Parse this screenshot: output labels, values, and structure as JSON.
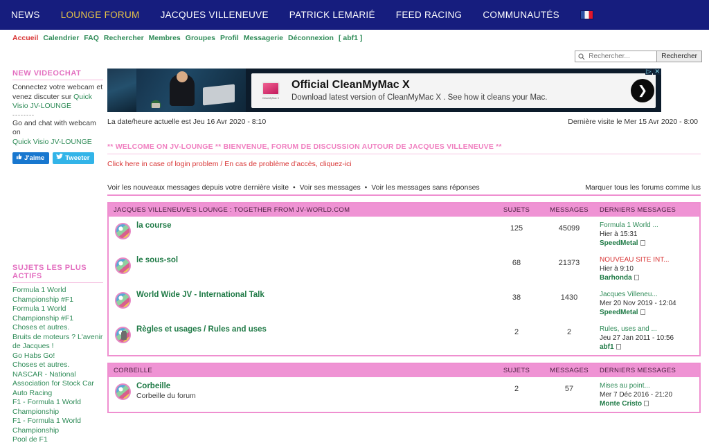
{
  "colors": {
    "nav_bg": "#161d7e",
    "nav_active": "#e8c547",
    "pink": "#ef93d4",
    "green_link": "#2e8b57",
    "red_link": "#d83535"
  },
  "topnav": {
    "items": [
      {
        "label": "NEWS",
        "active": false
      },
      {
        "label": "LOUNGE FORUM",
        "active": true
      },
      {
        "label": "JACQUES VILLENEUVE",
        "active": false
      },
      {
        "label": "PATRICK LEMARIÉ",
        "active": false
      },
      {
        "label": "FEED RACING",
        "active": false
      },
      {
        "label": "COMMUNAUTÉS",
        "active": false
      }
    ],
    "flag_icon": "flag-france-icon"
  },
  "subnav": {
    "items": [
      "Accueil",
      "Calendrier",
      "FAQ",
      "Rechercher",
      "Membres",
      "Groupes",
      "Profil",
      "Messagerie",
      "Déconnexion"
    ],
    "username_bracket": "[ abf1 ]"
  },
  "search": {
    "placeholder": "Rechercher...",
    "value": "",
    "button_label": "Rechercher",
    "icon": "search-icon"
  },
  "sidebar": {
    "videochat": {
      "heading": "NEW VIDEOCHAT",
      "line1": "Connectez votre webcam et",
      "line2": "venez discuter sur",
      "link1": "Quick Visio JV-LOUNGE",
      "divider": "--------",
      "line3": "Go and chat with webcam on",
      "link2": "Quick Visio JV-LOUNGE"
    },
    "social": {
      "facebook_label": "J'aime",
      "facebook_icon": "thumbs-up-icon",
      "twitter_label": "Tweeter",
      "twitter_icon": "twitter-bird-icon"
    },
    "active_topics": {
      "heading": "SUJETS LES PLUS ACTIFS",
      "items": [
        "Formula 1 World Championship #F1",
        "Formula 1 World Championship #F1",
        "Choses et autres.",
        "Bruits de moteurs ? L'avenir de Jacques !",
        "Go Habs Go!",
        "Choses et autres.",
        "NASCAR - National Association for Stock Car Auto Racing",
        "F1 - Formula 1 World Championship",
        "F1 - Formula 1 World Championship",
        "Pool de F1"
      ]
    }
  },
  "ad": {
    "title": "Official CleanMyMac X",
    "description": "Download latest version of CleanMyMac X . See how it cleans your Mac.",
    "icon_label": "CleanMyMac X",
    "arrow_icon": "chevron-right-icon",
    "adchoices_icon": "adchoices-icon",
    "close_icon": "close-icon"
  },
  "datebar": {
    "current": "La date/heure actuelle est Jeu 16 Avr 2020 - 8:10",
    "last_visit": "Dernière visite le Mer 15 Avr 2020 - 8:00"
  },
  "welcome": {
    "heading": "** WELCOME ON JV-LOUNGE ** BIENVENUE, FORUM DE DISCUSSION AUTOUR DE JACQUES VILLENEUVE **",
    "login_link": "Click here in case of login problem / En cas de problème d'accès, cliquez-ici"
  },
  "quicklinks": {
    "new_messages": "Voir les nouveaux messages depuis votre dernière visite",
    "own_messages": "Voir ses messages",
    "unanswered": "Voir les messages sans réponses",
    "separator": "•",
    "mark_read": "Marquer tous les forums comme lus"
  },
  "forum_sections": [
    {
      "title": "JACQUES VILLENEUVE'S LOUNGE : TOGETHER FROM JV-WORLD.COM",
      "col_subjects": "SUJETS",
      "col_messages": "MESSAGES",
      "col_last": "DERNIERS MESSAGES",
      "rows": [
        {
          "name": "la course",
          "desc": "",
          "subjects": "125",
          "messages": "45099",
          "last_topic": "Formula 1 World ...",
          "last_topic_red": false,
          "last_date": "Hier à 15:31",
          "last_author": "SpeedMetal",
          "icon": "forum-globe-icon",
          "locked": false
        },
        {
          "name": "le sous-sol",
          "desc": "",
          "subjects": "68",
          "messages": "21373",
          "last_topic": "NOUVEAU SITE INT...",
          "last_topic_red": true,
          "last_date": "Hier à 9:10",
          "last_author": "Barhonda",
          "icon": "forum-globe-icon",
          "locked": false
        },
        {
          "name": "World Wide JV - International Talk",
          "desc": "",
          "subjects": "38",
          "messages": "1430",
          "last_topic": "Jacques Villeneu...",
          "last_topic_red": false,
          "last_date": "Mer 20 Nov 2019 - 12:04",
          "last_author": "SpeedMetal",
          "icon": "forum-globe-icon",
          "locked": false
        },
        {
          "name": "Règles et usages / Rules and uses",
          "desc": "",
          "subjects": "2",
          "messages": "2",
          "last_topic": "Rules, uses and ...",
          "last_topic_red": false,
          "last_date": "Jeu 27 Jan 2011 - 10:56",
          "last_author": "abf1",
          "icon": "forum-locked-icon",
          "locked": true
        }
      ]
    },
    {
      "title": "CORBEILLE",
      "col_subjects": "SUJETS",
      "col_messages": "MESSAGES",
      "col_last": "DERNIERS MESSAGES",
      "rows": [
        {
          "name": "Corbeille",
          "desc": "Corbeille du forum",
          "subjects": "2",
          "messages": "57",
          "last_topic": "Mises au point...",
          "last_topic_red": false,
          "last_date": "Mer 7 Déc 2016 - 21:20",
          "last_author": "Monte Cristo",
          "icon": "forum-globe-icon",
          "locked": false
        }
      ]
    }
  ]
}
